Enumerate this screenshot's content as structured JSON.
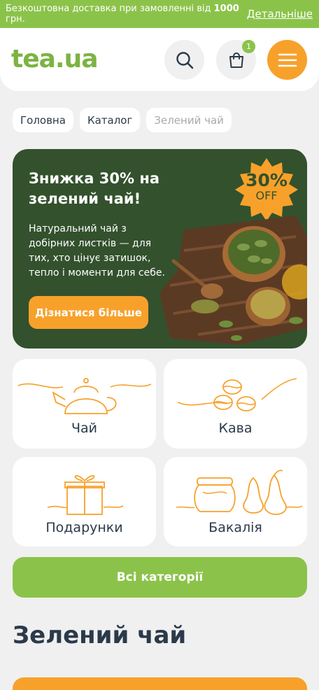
{
  "promo": {
    "message_prefix": "Безкоштовна доставка при замовленні від ",
    "message_amount": "1000",
    "message_suffix": " грн.",
    "link": "Детальніше"
  },
  "header": {
    "logo": "tea.ua",
    "cart_count": "1"
  },
  "breadcrumb": [
    "Головна",
    "Каталог",
    "Зелений чай"
  ],
  "banner": {
    "title": "Знижка 30% на зелений чай!",
    "text": "Натуральний чай з добірних листків — для тих, хто цінує затишок, тепло і моменти для себе.",
    "button": "Дізнатися більше",
    "badge_percent": "30%",
    "badge_off": "OFF"
  },
  "categories": [
    {
      "label": "Чай",
      "icon": "teapot-icon"
    },
    {
      "label": "Кава",
      "icon": "coffee-beans-icon"
    },
    {
      "label": "Подарунки",
      "icon": "gift-box-icon"
    },
    {
      "label": "Бакалія",
      "icon": "jar-and-pears-icon"
    }
  ],
  "all_categories_button": "Всі категорії",
  "page_title": "Зелений чай",
  "colors": {
    "accent_green": "#8bc34a",
    "accent_orange": "#f7a12b",
    "banner_green": "#33512d",
    "text_dark": "#2b3a4a"
  }
}
